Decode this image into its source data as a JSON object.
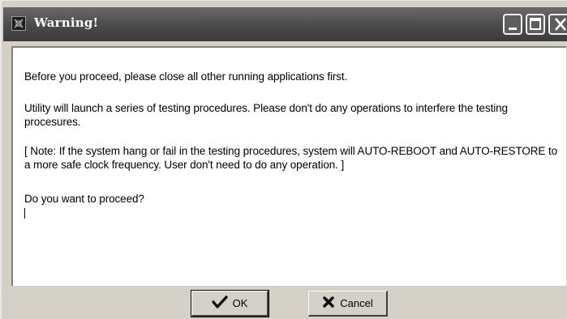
{
  "window": {
    "title": "Warning!",
    "icons": {
      "app": "app-icon",
      "minimize": "minimize-icon",
      "maximize": "maximize-icon",
      "close": "close-icon"
    }
  },
  "message": {
    "paragraphs": [
      "Before you proceed, please close all other running applications first.",
      "Utility will launch a series of testing procedures. Please don't do any operations to interfere the testing procesures.",
      "[ Note: If the system hang or fail in the testing procedures, system will AUTO-REBOOT and AUTO-RESTORE to a  more safe clock frequency. User don't need to do any operation. ]",
      "Do you want to proceed?"
    ]
  },
  "buttons": {
    "ok_label": "OK",
    "ok_icon": "checkmark-icon",
    "cancel_label": "Cancel",
    "cancel_icon": "x-mark-icon"
  }
}
